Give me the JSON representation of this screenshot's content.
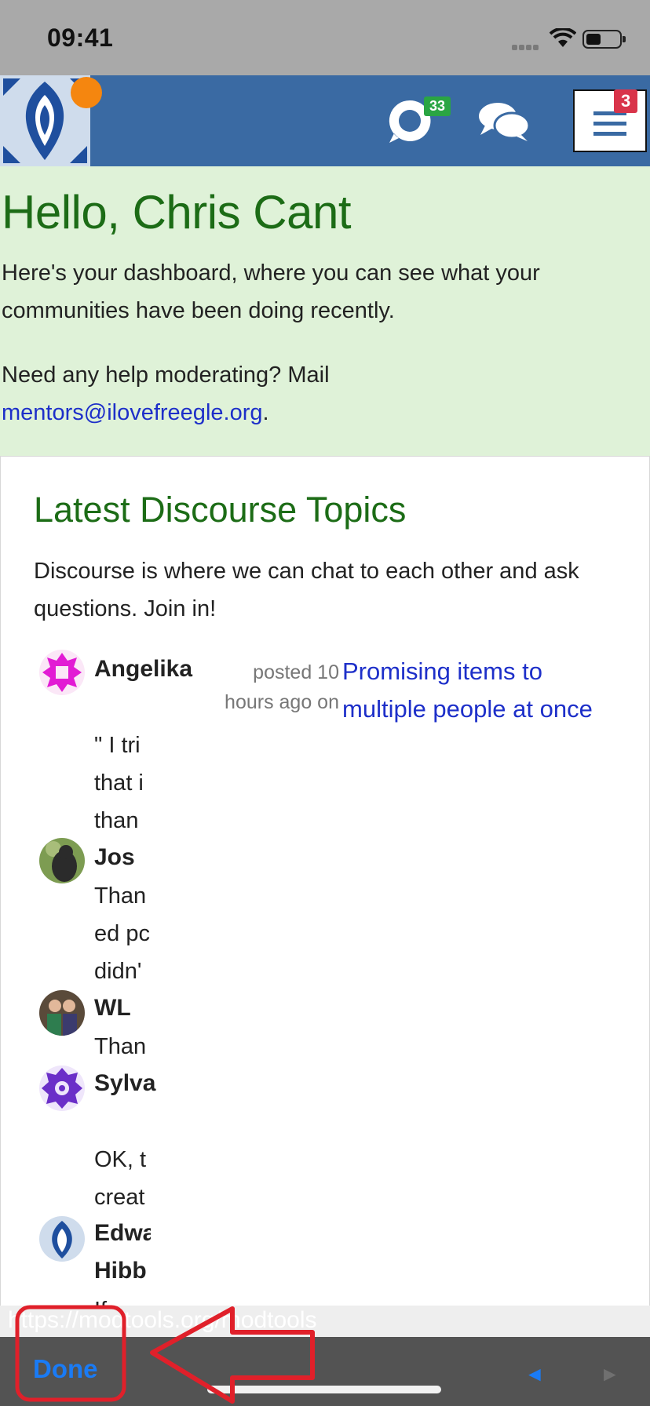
{
  "status_bar": {
    "time": "09:41"
  },
  "header": {
    "chat_badge": "33",
    "menu_badge": "3"
  },
  "greeting": {
    "title": "Hello, Chris Cant",
    "line1": "Here's your dashboard, where you can see what your communities have been doing recently.",
    "line2_prefix": "Need any help moderating? Mail ",
    "email": "mentors@ilovefreegle.org",
    "line2_suffix": "."
  },
  "discourse": {
    "title": "Latest Discourse Topics",
    "intro": "Discourse is where we can chat to each other and ask questions. Join in!",
    "first_post": {
      "user": "Angelika",
      "meta": "posted 10 hours ago on",
      "topic": "Promising items to multiple people at once",
      "excerpt": [
        "\" I tri",
        "that i",
        "than"
      ]
    },
    "posts": [
      {
        "user": "Jos",
        "excerpt": [
          "Than",
          "ed pc",
          "didn'"
        ]
      },
      {
        "user": "WL",
        "excerpt": [
          "Than"
        ]
      },
      {
        "user": "Sylva",
        "excerpt": [
          "OK, t",
          "creat"
        ]
      },
      {
        "user": [
          "Edwa",
          "Hibb"
        ],
        "excerpt": [
          "If"
        ]
      }
    ]
  },
  "browser": {
    "url": "https://modtools.org/modtools",
    "done_label": "Done",
    "back_label": "◄",
    "forward_label": "►"
  },
  "colors": {
    "header_blue": "#3a6aa3",
    "greeting_bg": "#dff2d8",
    "heading_green": "#1c6c16",
    "link_blue": "#1d2fc9",
    "annotation_red": "#e0202a"
  }
}
